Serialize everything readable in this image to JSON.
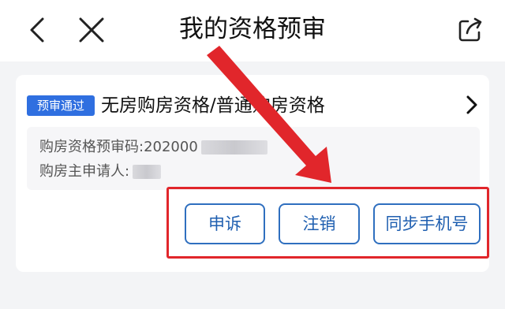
{
  "nav": {
    "title": "我的资格预审",
    "back_icon": "chevron-left-icon",
    "close_icon": "close-icon",
    "share_icon": "share-icon"
  },
  "card": {
    "badge": "预审通过",
    "title": "无房购房资格/普通购房资格",
    "chevron_icon": "chevron-right-icon",
    "code_label": "购房资格预审码:",
    "code_value": "202000",
    "applicant_label": "购房主申请人:"
  },
  "actions": {
    "appeal": "申诉",
    "cancel": "注销",
    "sync_phone": "同步手机号"
  },
  "annotation": {
    "color": "#e1262b"
  }
}
